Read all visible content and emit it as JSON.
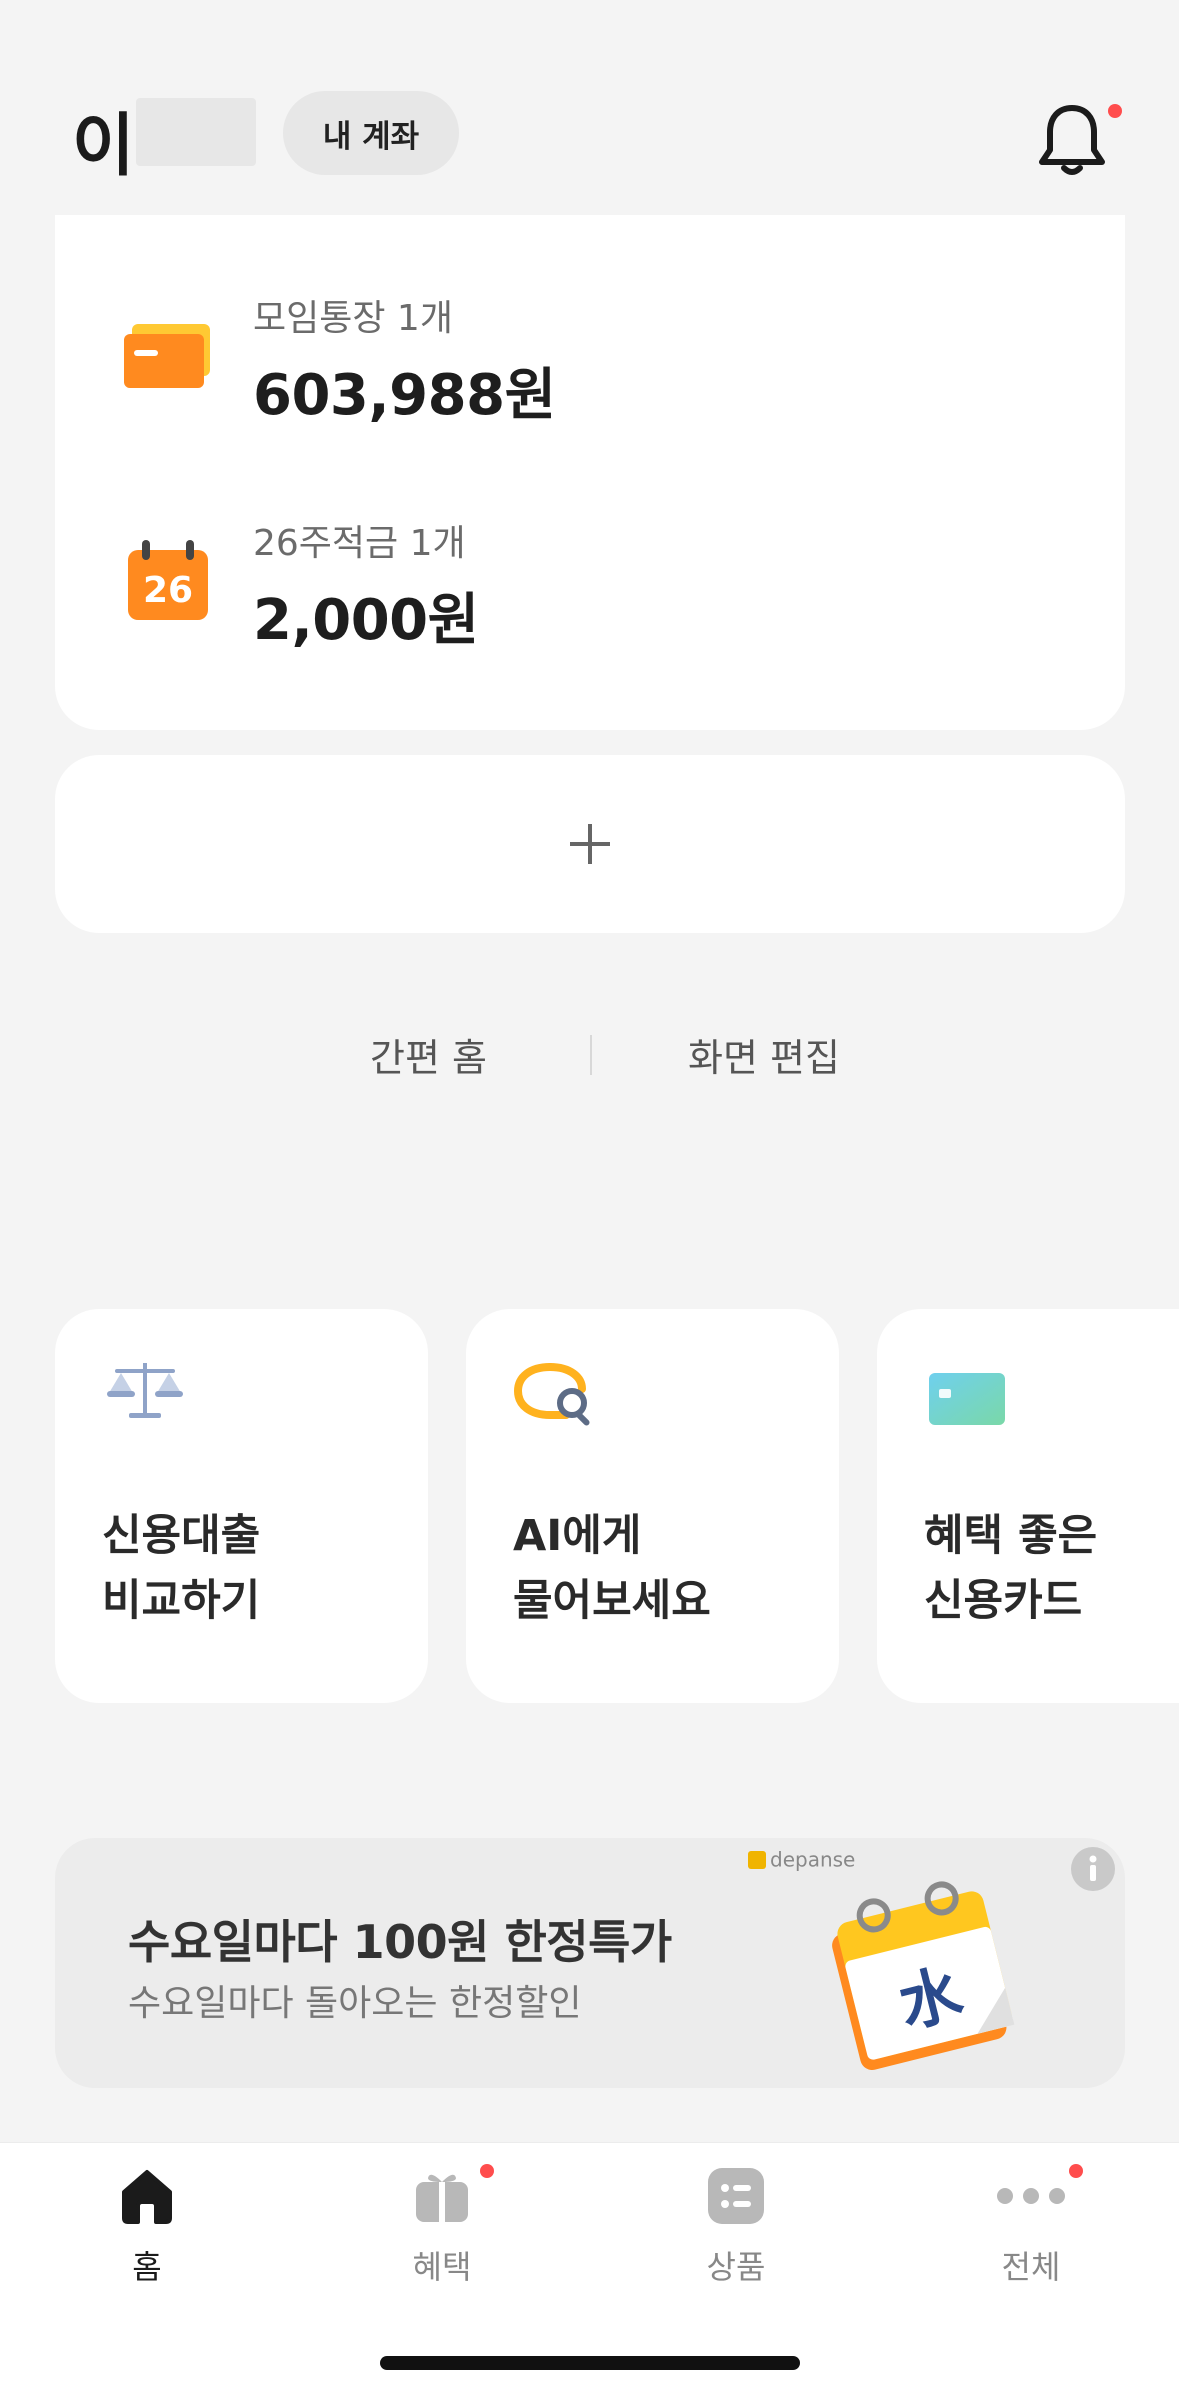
{
  "header": {
    "user_name": "이",
    "account_button": "내 계좌",
    "bell_icon": "bell-icon",
    "has_notification": true
  },
  "accounts": [
    {
      "icon": "card-stack-icon",
      "label": "모임통장 1개",
      "amount": "603,988원"
    },
    {
      "icon": "calendar-26-icon",
      "label": "26주적금 1개",
      "amount": "2,000원",
      "icon_text": "26"
    }
  ],
  "add_card": {
    "icon": "plus-icon"
  },
  "links": {
    "simple_home": "간편 홈",
    "edit_screen": "화면 편집"
  },
  "quick_cards": [
    {
      "icon": "scale-icon",
      "line1": "신용대출",
      "line2": "비교하기"
    },
    {
      "icon": "ai-search-icon",
      "line1": "AI에게",
      "line2": "물어보세요"
    },
    {
      "icon": "credit-card-icon",
      "line1": "혜택 좋은",
      "line2": "신용카드"
    }
  ],
  "banner": {
    "title": "수요일마다 100원 한정특가",
    "subtitle": "수요일마다 돌아오는 한정할인",
    "brand": "depanse",
    "calendar_char": "水"
  },
  "tabbar": [
    {
      "label": "홈",
      "icon": "home-icon",
      "active": true,
      "dot": false
    },
    {
      "label": "혜택",
      "icon": "gift-icon",
      "active": false,
      "dot": true
    },
    {
      "label": "상품",
      "icon": "list-icon",
      "active": false,
      "dot": false
    },
    {
      "label": "전체",
      "icon": "more-icon",
      "active": false,
      "dot": true
    }
  ],
  "colors": {
    "background": "#f4f4f4",
    "card": "#ffffff",
    "orange": "#ff8a1f",
    "notification_dot": "#ff4d4d",
    "tab_active": "#1b1b1b",
    "tab_inactive": "#b8b8b8"
  }
}
